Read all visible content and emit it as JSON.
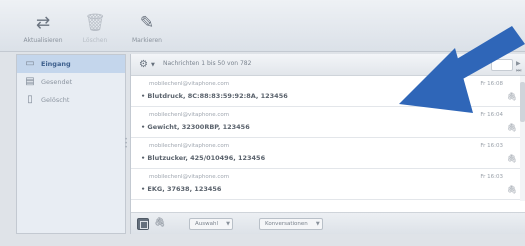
{
  "toolbar": {
    "buttons": [
      {
        "label": "Aktualisieren",
        "icon": "refresh-arrows-icon",
        "enabled": true
      },
      {
        "label": "Löschen",
        "icon": "trash-icon",
        "enabled": false
      },
      {
        "label": "Markieren",
        "icon": "pen-icon",
        "enabled": true
      }
    ]
  },
  "sidebar": {
    "items": [
      {
        "label": "Eingang",
        "icon": "inbox-icon",
        "active": true
      },
      {
        "label": "Gesendet",
        "icon": "sent-icon",
        "active": false
      },
      {
        "label": "Gelöscht",
        "icon": "trash-icon",
        "active": false
      }
    ]
  },
  "list": {
    "pagination": "Nachrichten 1 bis 50 von 782",
    "messages": [
      {
        "from": "mobilechenl@vitaphone.com",
        "subject": "Blutdruck, 8C:88:83:59:92:8A, 123456",
        "time": "Fr 16:08"
      },
      {
        "from": "mobilechenl@vitaphone.com",
        "subject": "Gewicht, 32300RBP, 123456",
        "time": "Fr 16:04"
      },
      {
        "from": "mobilechenl@vitaphone.com",
        "subject": "Blutzucker, 425/010496, 123456",
        "time": "Fr 16:03"
      },
      {
        "from": "mobilechenl@vitaphone.com",
        "subject": "EKG, 37638, 123456",
        "time": "Fr 16:03"
      }
    ]
  },
  "footer": {
    "select_label": "Auswahl",
    "threads_label": "Konversationen"
  },
  "colors": {
    "arrow": "#2f66b8",
    "sidebar_active_bg": "#c4d6ec"
  }
}
